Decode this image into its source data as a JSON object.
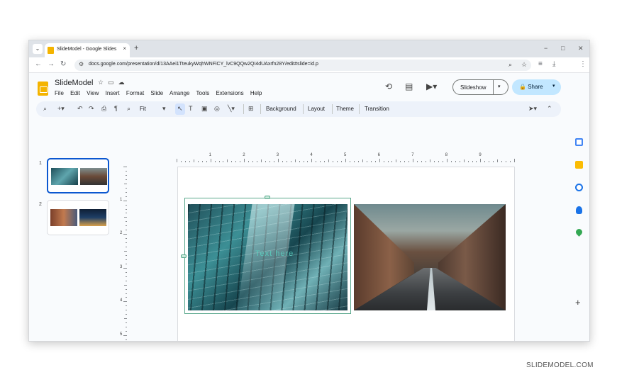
{
  "browser": {
    "tab_title": "SlideModel - Google Slides",
    "tab_close": "×",
    "new_tab": "+",
    "tab_menu": "⌄",
    "window_controls": [
      "−",
      "□",
      "✕"
    ],
    "url": "docs.google.com/presentation/d/13AAei1TteukyWqhWNFiCY_lvC9QQw2QI4dUAxrfn28Y/edit#slide=id.p"
  },
  "doc": {
    "title": "SlideModel",
    "menu": [
      "File",
      "Edit",
      "View",
      "Insert",
      "Format",
      "Slide",
      "Arrange",
      "Tools",
      "Extensions",
      "Help"
    ],
    "slideshow_label": "Slideshow",
    "share_label": "Share"
  },
  "toolbar": {
    "zoom": "Fit",
    "background_label": "Background",
    "layout_label": "Layout",
    "theme_label": "Theme",
    "transition_label": "Transition"
  },
  "slides": [
    {
      "number": "1",
      "selected": true
    },
    {
      "number": "2",
      "selected": false
    }
  ],
  "ruler": {
    "horizontal": [
      "1",
      "2",
      "3",
      "4",
      "5",
      "6",
      "7",
      "8",
      "9"
    ],
    "vertical": [
      "1",
      "2",
      "3",
      "4",
      "5"
    ]
  },
  "canvas": {
    "overlay_text": "Text here"
  },
  "colors": {
    "accent": "#0b57d0",
    "share_bg": "#c2e7ff",
    "toolbar_bg": "#edf2fa",
    "selection": "#5aa88c"
  },
  "watermark": "SLIDEMODEL.COM"
}
